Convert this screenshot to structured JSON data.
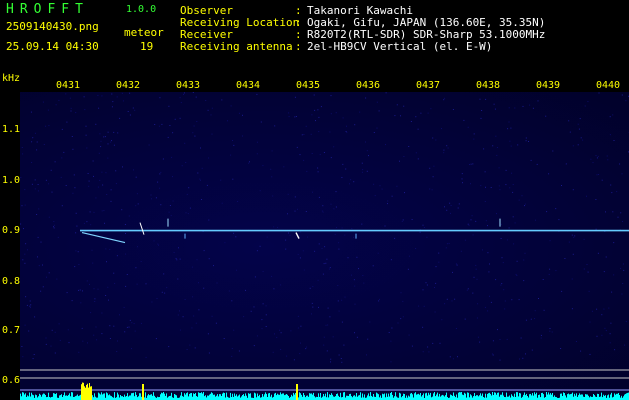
{
  "header": {
    "app_title": "HROFFT",
    "version": "1.0.0",
    "filename": "2509140430.png",
    "datetime": "25.09.14 04:30",
    "meteor_label": "meteor",
    "meteor_count": "19"
  },
  "station_info": [
    {
      "label": "Observer",
      "value": "Takanori Kawachi"
    },
    {
      "label": "Receiving Location",
      "value": "Ogaki, Gifu, JAPAN (136.60E, 35.35N)"
    },
    {
      "label": "Receiver",
      "value": "R820T2(RTL-SDR) SDR-Sharp 53.1000MHz"
    },
    {
      "label": "Receiving antenna",
      "value": "2el-HB9CV Vertical (el. E-W)"
    }
  ],
  "axis": {
    "unit": "kHz",
    "time_ticks": [
      "0431",
      "0432",
      "0433",
      "0434",
      "0435",
      "0436",
      "0437",
      "0438",
      "0439",
      "0440"
    ],
    "freq_ticks": [
      "1.1",
      "1.0",
      "0.9",
      "0.8",
      "0.7",
      "0.6"
    ],
    "freq_range_khz": [
      0.57,
      1.17
    ]
  },
  "signal": {
    "carrier_khz": 0.9,
    "carrier_start_time": "0431",
    "carrier_end_time": "0440"
  },
  "colors": {
    "label_yellow": "#ffff00",
    "info_white": "#ffffff",
    "title_green": "#33ff33",
    "background_blue": "#020238",
    "carrier_cyan": "#66ccff",
    "level_cyan": "#00ffff"
  }
}
